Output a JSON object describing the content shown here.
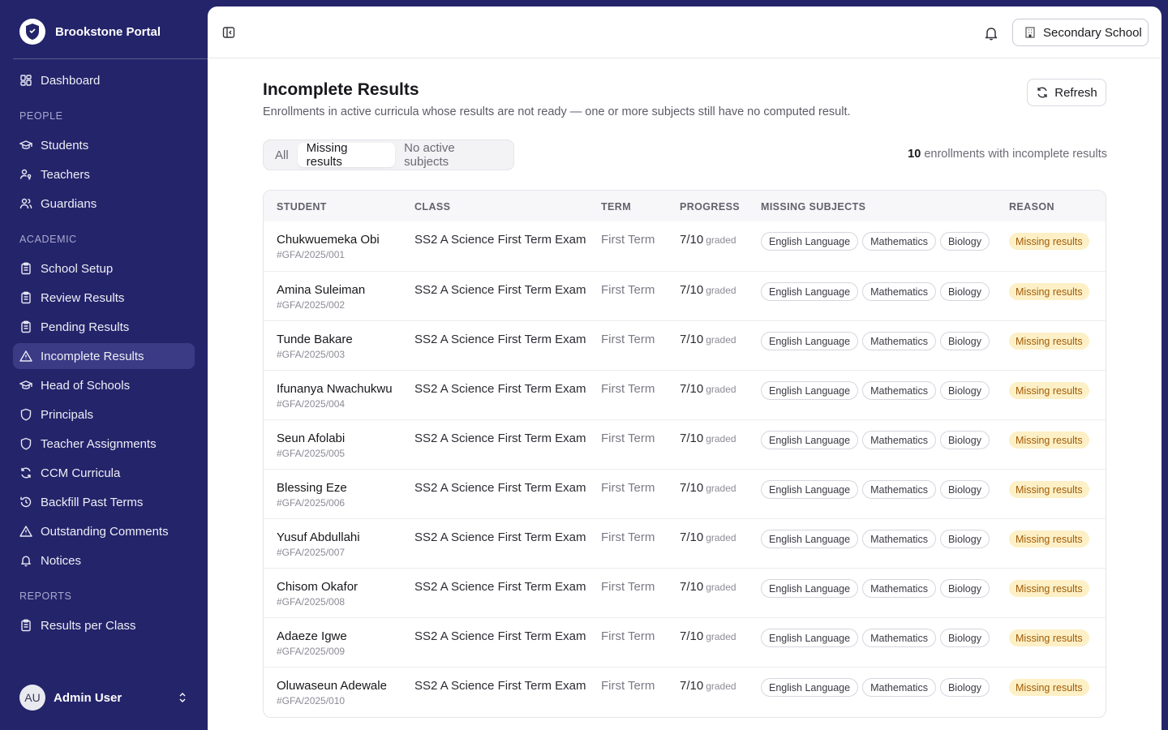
{
  "app": {
    "name": "Brookstone Portal"
  },
  "sidebar": {
    "top_items": [
      {
        "label": "Dashboard",
        "icon": "dashboard-icon"
      }
    ],
    "sections": [
      {
        "title": "PEOPLE",
        "items": [
          {
            "label": "Students",
            "icon": "graduation-cap-icon"
          },
          {
            "label": "Teachers",
            "icon": "user-key-icon"
          },
          {
            "label": "Guardians",
            "icon": "users-icon"
          }
        ]
      },
      {
        "title": "ACADEMIC",
        "items": [
          {
            "label": "School Setup",
            "icon": "clipboard-icon"
          },
          {
            "label": "Review Results",
            "icon": "clipboard-icon"
          },
          {
            "label": "Pending Results",
            "icon": "clipboard-icon"
          },
          {
            "label": "Incomplete Results",
            "icon": "warning-icon",
            "active": true
          },
          {
            "label": "Head of Schools",
            "icon": "graduation-cap-icon"
          },
          {
            "label": "Principals",
            "icon": "shield-icon"
          },
          {
            "label": "Teacher Assignments",
            "icon": "shield-icon"
          },
          {
            "label": "CCM Curricula",
            "icon": "refresh-icon"
          },
          {
            "label": "Backfill Past Terms",
            "icon": "history-icon"
          },
          {
            "label": "Outstanding Comments",
            "icon": "warning-icon"
          },
          {
            "label": "Notices",
            "icon": "bell-icon"
          }
        ]
      },
      {
        "title": "REPORTS",
        "items": [
          {
            "label": "Results per Class",
            "icon": "clipboard-icon"
          }
        ]
      }
    ],
    "user": {
      "initials": "AU",
      "name": "Admin User"
    }
  },
  "topbar": {
    "school_label": "Secondary School"
  },
  "page": {
    "title": "Incomplete Results",
    "description": "Enrollments in active curricula whose results are not ready — one or more subjects still have no computed result.",
    "refresh_label": "Refresh",
    "tabs": [
      {
        "label": "All",
        "active": false
      },
      {
        "label": "Missing results",
        "active": true
      },
      {
        "label": "No active subjects",
        "active": false
      }
    ],
    "count_value": "10",
    "count_text": " enrollments with incomplete results"
  },
  "table": {
    "headers": [
      "STUDENT",
      "CLASS",
      "TERM",
      "PROGRESS",
      "MISSING SUBJECTS",
      "REASON"
    ],
    "graded_suffix": "graded",
    "rows": [
      {
        "name": "Chukwuemeka Obi",
        "id": "#GFA/2025/001",
        "class": "SS2 A Science First Term Exam",
        "term": "First Term",
        "progress": "7/10",
        "missing": [
          "English Language",
          "Mathematics",
          "Biology"
        ],
        "reason": "Missing results"
      },
      {
        "name": "Amina Suleiman",
        "id": "#GFA/2025/002",
        "class": "SS2 A Science First Term Exam",
        "term": "First Term",
        "progress": "7/10",
        "missing": [
          "English Language",
          "Mathematics",
          "Biology"
        ],
        "reason": "Missing results"
      },
      {
        "name": "Tunde Bakare",
        "id": "#GFA/2025/003",
        "class": "SS2 A Science First Term Exam",
        "term": "First Term",
        "progress": "7/10",
        "missing": [
          "English Language",
          "Mathematics",
          "Biology"
        ],
        "reason": "Missing results"
      },
      {
        "name": "Ifunanya Nwachukwu",
        "id": "#GFA/2025/004",
        "class": "SS2 A Science First Term Exam",
        "term": "First Term",
        "progress": "7/10",
        "missing": [
          "English Language",
          "Mathematics",
          "Biology"
        ],
        "reason": "Missing results"
      },
      {
        "name": "Seun Afolabi",
        "id": "#GFA/2025/005",
        "class": "SS2 A Science First Term Exam",
        "term": "First Term",
        "progress": "7/10",
        "missing": [
          "English Language",
          "Mathematics",
          "Biology"
        ],
        "reason": "Missing results"
      },
      {
        "name": "Blessing Eze",
        "id": "#GFA/2025/006",
        "class": "SS2 A Science First Term Exam",
        "term": "First Term",
        "progress": "7/10",
        "missing": [
          "English Language",
          "Mathematics",
          "Biology"
        ],
        "reason": "Missing results"
      },
      {
        "name": "Yusuf Abdullahi",
        "id": "#GFA/2025/007",
        "class": "SS2 A Science First Term Exam",
        "term": "First Term",
        "progress": "7/10",
        "missing": [
          "English Language",
          "Mathematics",
          "Biology"
        ],
        "reason": "Missing results"
      },
      {
        "name": "Chisom Okafor",
        "id": "#GFA/2025/008",
        "class": "SS2 A Science First Term Exam",
        "term": "First Term",
        "progress": "7/10",
        "missing": [
          "English Language",
          "Mathematics",
          "Biology"
        ],
        "reason": "Missing results"
      },
      {
        "name": "Adaeze Igwe",
        "id": "#GFA/2025/009",
        "class": "SS2 A Science First Term Exam",
        "term": "First Term",
        "progress": "7/10",
        "missing": [
          "English Language",
          "Mathematics",
          "Biology"
        ],
        "reason": "Missing results"
      },
      {
        "name": "Oluwaseun Adewale",
        "id": "#GFA/2025/010",
        "class": "SS2 A Science First Term Exam",
        "term": "First Term",
        "progress": "7/10",
        "missing": [
          "English Language",
          "Mathematics",
          "Biology"
        ],
        "reason": "Missing results"
      }
    ]
  },
  "colors": {
    "sidebar_bg": "#24246b",
    "active_item_bg": "#3a3a85",
    "badge_bg": "#fdf0c6",
    "badge_text": "#a15b06"
  }
}
